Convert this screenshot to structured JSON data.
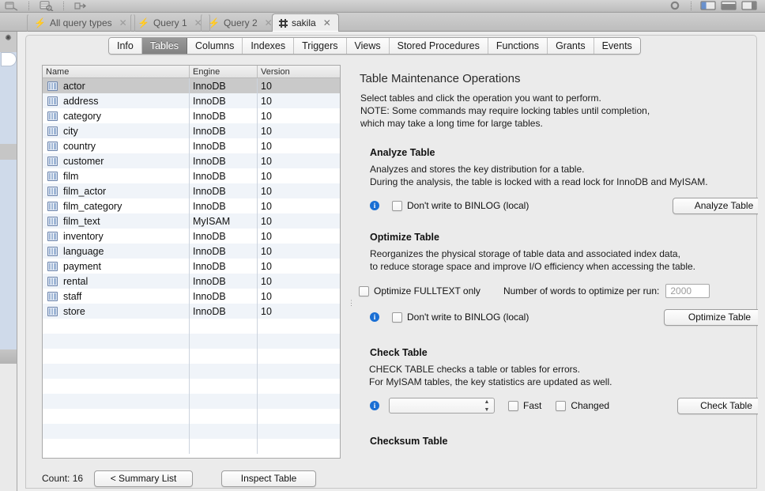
{
  "window": {
    "toolbar_icons": [
      "sql-editor-icon",
      "inspect-icon",
      "import-icon",
      "gear-icon",
      "panel-left-icon",
      "panel-bottom-icon",
      "panel-right-icon"
    ]
  },
  "tabs": [
    {
      "label": "All query types",
      "icon": "lightning-bolt-icon",
      "active": false,
      "close": "✕"
    },
    {
      "label": "Query 1",
      "icon": "lightning-bolt-icon",
      "active": false,
      "close": "✕"
    },
    {
      "label": "Query 2",
      "icon": "lightning-bolt-icon",
      "active": false,
      "close": "✕"
    },
    {
      "label": "sakila",
      "icon": "schema-grid-icon",
      "active": true,
      "close": "✕"
    }
  ],
  "subtabs": [
    {
      "label": "Info",
      "active": false
    },
    {
      "label": "Tables",
      "active": true
    },
    {
      "label": "Columns",
      "active": false
    },
    {
      "label": "Indexes",
      "active": false
    },
    {
      "label": "Triggers",
      "active": false
    },
    {
      "label": "Views",
      "active": false
    },
    {
      "label": "Stored Procedures",
      "active": false
    },
    {
      "label": "Functions",
      "active": false
    },
    {
      "label": "Grants",
      "active": false
    },
    {
      "label": "Events",
      "active": false
    }
  ],
  "table_list": {
    "columns": [
      "Name",
      "Engine",
      "Version"
    ],
    "rows": [
      {
        "name": "actor",
        "engine": "InnoDB",
        "version": "10",
        "selected": true
      },
      {
        "name": "address",
        "engine": "InnoDB",
        "version": "10",
        "selected": false
      },
      {
        "name": "category",
        "engine": "InnoDB",
        "version": "10",
        "selected": false
      },
      {
        "name": "city",
        "engine": "InnoDB",
        "version": "10",
        "selected": false
      },
      {
        "name": "country",
        "engine": "InnoDB",
        "version": "10",
        "selected": false
      },
      {
        "name": "customer",
        "engine": "InnoDB",
        "version": "10",
        "selected": false
      },
      {
        "name": "film",
        "engine": "InnoDB",
        "version": "10",
        "selected": false
      },
      {
        "name": "film_actor",
        "engine": "InnoDB",
        "version": "10",
        "selected": false
      },
      {
        "name": "film_category",
        "engine": "InnoDB",
        "version": "10",
        "selected": false
      },
      {
        "name": "film_text",
        "engine": "MyISAM",
        "version": "10",
        "selected": false
      },
      {
        "name": "inventory",
        "engine": "InnoDB",
        "version": "10",
        "selected": false
      },
      {
        "name": "language",
        "engine": "InnoDB",
        "version": "10",
        "selected": false
      },
      {
        "name": "payment",
        "engine": "InnoDB",
        "version": "10",
        "selected": false
      },
      {
        "name": "rental",
        "engine": "InnoDB",
        "version": "10",
        "selected": false
      },
      {
        "name": "staff",
        "engine": "InnoDB",
        "version": "10",
        "selected": false
      },
      {
        "name": "store",
        "engine": "InnoDB",
        "version": "10",
        "selected": false
      }
    ],
    "count_label": "Count: 16",
    "summary_button": "< Summary List",
    "inspect_button": "Inspect Table"
  },
  "maintenance": {
    "title": "Table Maintenance Operations",
    "intro_line1": "Select tables and click the operation you want to perform.",
    "intro_line2": "NOTE: Some commands may require locking tables until completion,",
    "intro_line3": "which may take a long time for large tables.",
    "analyze": {
      "heading": "Analyze Table",
      "desc_line1": "Analyzes and stores the key distribution for a table.",
      "desc_line2": "During the analysis, the table is locked with a read lock for InnoDB and MyISAM.",
      "binlog_label": "Don't write to BINLOG (local)",
      "binlog_checked": false,
      "button": "Analyze Table"
    },
    "optimize": {
      "heading": "Optimize Table",
      "desc_line1": "Reorganizes the physical storage of table data and associated index data,",
      "desc_line2": "to reduce storage space and improve I/O efficiency when accessing the table.",
      "fulltext_label": "Optimize FULLTEXT only",
      "fulltext_checked": false,
      "words_label": "Number of words to optimize per run:",
      "words_placeholder": "2000",
      "words_value": "",
      "binlog_label": "Don't write to BINLOG (local)",
      "binlog_checked": false,
      "button": "Optimize Table"
    },
    "check": {
      "heading": "Check Table",
      "desc_line1": "CHECK TABLE checks a table or tables for errors.",
      "desc_line2": "For MyISAM tables, the key statistics are updated as well.",
      "option_value": "",
      "fast_label": "Fast",
      "fast_checked": false,
      "changed_label": "Changed",
      "changed_checked": false,
      "button": "Check Table"
    },
    "checksum": {
      "heading": "Checksum Table"
    }
  },
  "colors": {
    "accent_info": "#1a6fd4",
    "selection": "#c9c9c9",
    "row_alt": "#f0f4f9",
    "panel_bg": "#ebebeb"
  }
}
